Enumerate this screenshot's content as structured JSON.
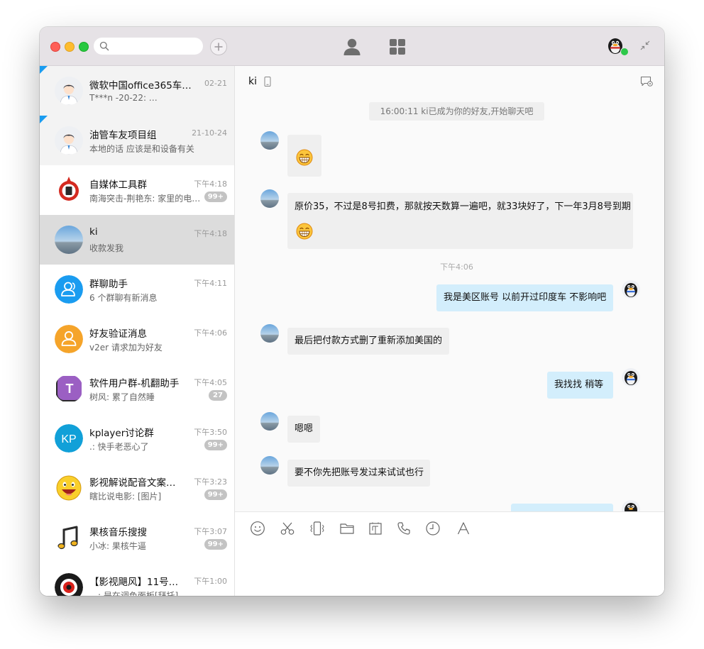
{
  "window": {
    "search": {
      "value": "",
      "placeholder": ""
    },
    "top_tabs": [
      {
        "name": "messages",
        "icon": "chat-bubble-icon",
        "active": true
      },
      {
        "name": "contacts",
        "icon": "person-icon",
        "active": false
      },
      {
        "name": "apps",
        "icon": "grid-icon",
        "active": false
      }
    ],
    "accent_color": "#1a9cf0",
    "online_color": "#2ec84a"
  },
  "conversations": [
    {
      "name": "微软中国office365车…",
      "time": "02-21",
      "preview": "T***n -20-22: …",
      "badge": "",
      "pinned": true,
      "selected": false,
      "avatar": "user-avatar-icon"
    },
    {
      "name": "油管车友项目组",
      "time": "21-10-24",
      "preview": "本地的话 应该是和设备有关",
      "badge": "",
      "pinned": true,
      "selected": false,
      "avatar": "user-avatar-icon"
    },
    {
      "name": "自媒体工具群",
      "time": "下午4:18",
      "preview": "南海突击-荆艳东: 家里的电…",
      "badge": "99+",
      "pinned": false,
      "selected": false,
      "avatar": "brand-logo-icon"
    },
    {
      "name": "ki",
      "time": "下午4:18",
      "preview": "收款发我",
      "badge": "",
      "pinned": false,
      "selected": true,
      "avatar": "landscape-avatar-icon"
    },
    {
      "name": "群聊助手",
      "time": "下午4:11",
      "preview": "6 个群聊有新消息",
      "badge": "",
      "pinned": false,
      "selected": false,
      "avatar": "group-assistant-icon"
    },
    {
      "name": "好友验证消息",
      "time": "下午4:06",
      "preview": "v2er 请求加为好友",
      "badge": "",
      "pinned": false,
      "selected": false,
      "avatar": "friend-verify-icon"
    },
    {
      "name": "软件用户群-机翻助手",
      "time": "下午4:05",
      "preview": "树风: 累了自然睡",
      "badge": "27",
      "pinned": false,
      "selected": false,
      "avatar": "t-logo-icon"
    },
    {
      "name": "kplayer讨论群",
      "time": "下午3:50",
      "preview": ".: 快手老恶心了",
      "badge": "99+",
      "pinned": false,
      "selected": false,
      "avatar": "kp-logo-icon"
    },
    {
      "name": "影视解说配音文案…",
      "time": "下午3:23",
      "preview": "瞎比说电影: [图片]",
      "badge": "99+",
      "pinned": false,
      "selected": false,
      "avatar": "smiley-icon"
    },
    {
      "name": "果核音乐搜搜",
      "time": "下午3:07",
      "preview": "小冰: 果核牛逼",
      "badge": "99+",
      "pinned": false,
      "selected": false,
      "avatar": "music-note-icon"
    },
    {
      "name": "【影视飓风】11号…",
      "time": "下午1:00",
      "preview": "…: 是在调色面板[拜托]",
      "badge": "",
      "pinned": false,
      "selected": false,
      "avatar": "camera-logo-icon"
    }
  ],
  "chat": {
    "title": "ki",
    "system_message": "16:00:11 ki已成为你的好友,开始聊天吧",
    "time_divider": "下午4:06",
    "messages": [
      {
        "side": "in",
        "text": "",
        "emoji": "grin-emoji-icon"
      },
      {
        "side": "in",
        "text": "原价35，不过是8号扣费，那就按天数算一遍吧，就33块好了，下一年3月8号到期",
        "emoji": "grin-emoji-icon"
      },
      {
        "side": "out",
        "text": "我是美区账号 以前开过印度车 不影响吧",
        "emoji": ""
      },
      {
        "side": "in",
        "text": "最后把付款方式删了重新添加美国的",
        "emoji": ""
      },
      {
        "side": "out",
        "text": "我找找 稍等",
        "emoji": ""
      },
      {
        "side": "in",
        "text": "嗯嗯",
        "emoji": ""
      },
      {
        "side": "in",
        "text": "要不你先把账号发过来试试也行",
        "emoji": ""
      },
      {
        "side": "out",
        "text": "",
        "emoji": ""
      }
    ],
    "toolbar": [
      "emoji-icon",
      "scissors-icon",
      "vibrate-icon",
      "folder-icon",
      "screenshot-icon",
      "phone-call-icon",
      "history-clock-icon",
      "font-icon"
    ]
  }
}
